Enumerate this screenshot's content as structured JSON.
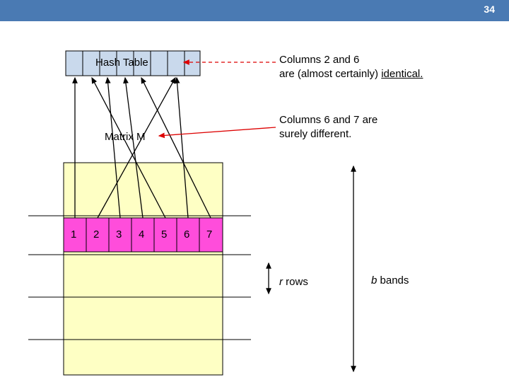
{
  "page": {
    "number": "34"
  },
  "labels": {
    "hash_table": "Hash Table",
    "matrix_m": "Matrix M",
    "r_rows_i": "r",
    "r_rows_n": "rows",
    "b_bands_i": "b",
    "b_bands_n": "bands"
  },
  "note1": {
    "line1": "Columns 2 and 6",
    "line2a": "are (almost certainly) ",
    "line2b_u": "identical."
  },
  "note2": {
    "line1": "Columns 6 and 7 are",
    "line2": "surely different."
  },
  "columns": {
    "c1": "1",
    "c2": "2",
    "c3": "3",
    "c4": "4",
    "c5": "5",
    "c6": "6",
    "c7": "7"
  }
}
